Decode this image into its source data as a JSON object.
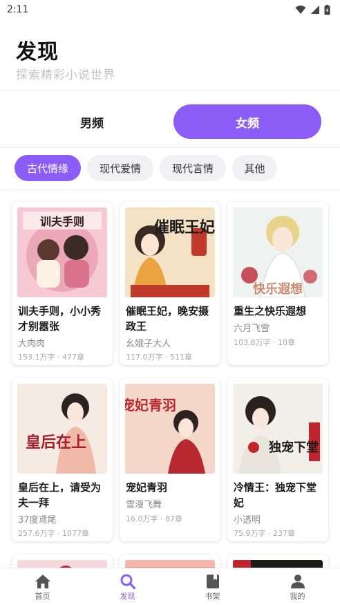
{
  "status_bar": {
    "time": "2:11"
  },
  "header": {
    "title": "发现",
    "subtitle": "探索精彩小说世界"
  },
  "gender_tabs": {
    "male": "男频",
    "female": "女频",
    "selected": "女频"
  },
  "categories": [
    {
      "label": "古代情缘",
      "active": true
    },
    {
      "label": "现代爱情",
      "active": false
    },
    {
      "label": "现代言情",
      "active": false
    },
    {
      "label": "其他",
      "active": false
    }
  ],
  "books": [
    {
      "title_line1": "训夫手则，小小秀",
      "title_line2": "才别嚣张",
      "author": "大肉肉",
      "meta": "153.1万字 · 477章",
      "cover_text": "训夫手则",
      "cover_colors": [
        "#f7c9d4",
        "#d9738c"
      ]
    },
    {
      "title_line1": "催眠王妃，晚安摄",
      "title_line2": "政王",
      "author": "幺娥子大人",
      "meta": "117.0万字 · 511章",
      "cover_text": "催眠王妃",
      "cover_colors": [
        "#f4e2c4",
        "#c0392b"
      ]
    },
    {
      "title_line1": "重生之快乐遐想",
      "title_line2": "",
      "author": "六月飞雪",
      "meta": "103.8万字 · 10章",
      "cover_text": "快乐遐想",
      "cover_colors": [
        "#eef2f0",
        "#c98b6d"
      ]
    },
    {
      "title_line1": "皇后在上，请受为",
      "title_line2": "夫一拜",
      "author": "37度鸢尾",
      "meta": "257.6万字 · 1077章",
      "cover_text": "皇后在上",
      "cover_colors": [
        "#f6ebe2",
        "#a31d2a"
      ]
    },
    {
      "title_line1": "宠妃青羽",
      "title_line2": "",
      "author": "雪漫飞舞",
      "meta": "16.0万字 · 87章",
      "cover_text": "宠妃青羽",
      "cover_colors": [
        "#f3d7c8",
        "#b8282f"
      ]
    },
    {
      "title_line1": "冷情王：独宠下堂",
      "title_line2": "妃",
      "author": "小透明",
      "meta": "75.9万字 · 237章",
      "cover_text": "独宠下堂",
      "cover_colors": [
        "#f2efe8",
        "#c0252d"
      ]
    }
  ],
  "bottom_nav": [
    {
      "label": "首页",
      "icon": "home-icon",
      "active": false
    },
    {
      "label": "发现",
      "icon": "search-icon",
      "active": true
    },
    {
      "label": "书架",
      "icon": "bookshelf-icon",
      "active": false
    },
    {
      "label": "我的",
      "icon": "profile-icon",
      "active": false
    }
  ],
  "colors": {
    "accent": "#8b5cf6",
    "inactive_chip": "#f1f1f3"
  }
}
